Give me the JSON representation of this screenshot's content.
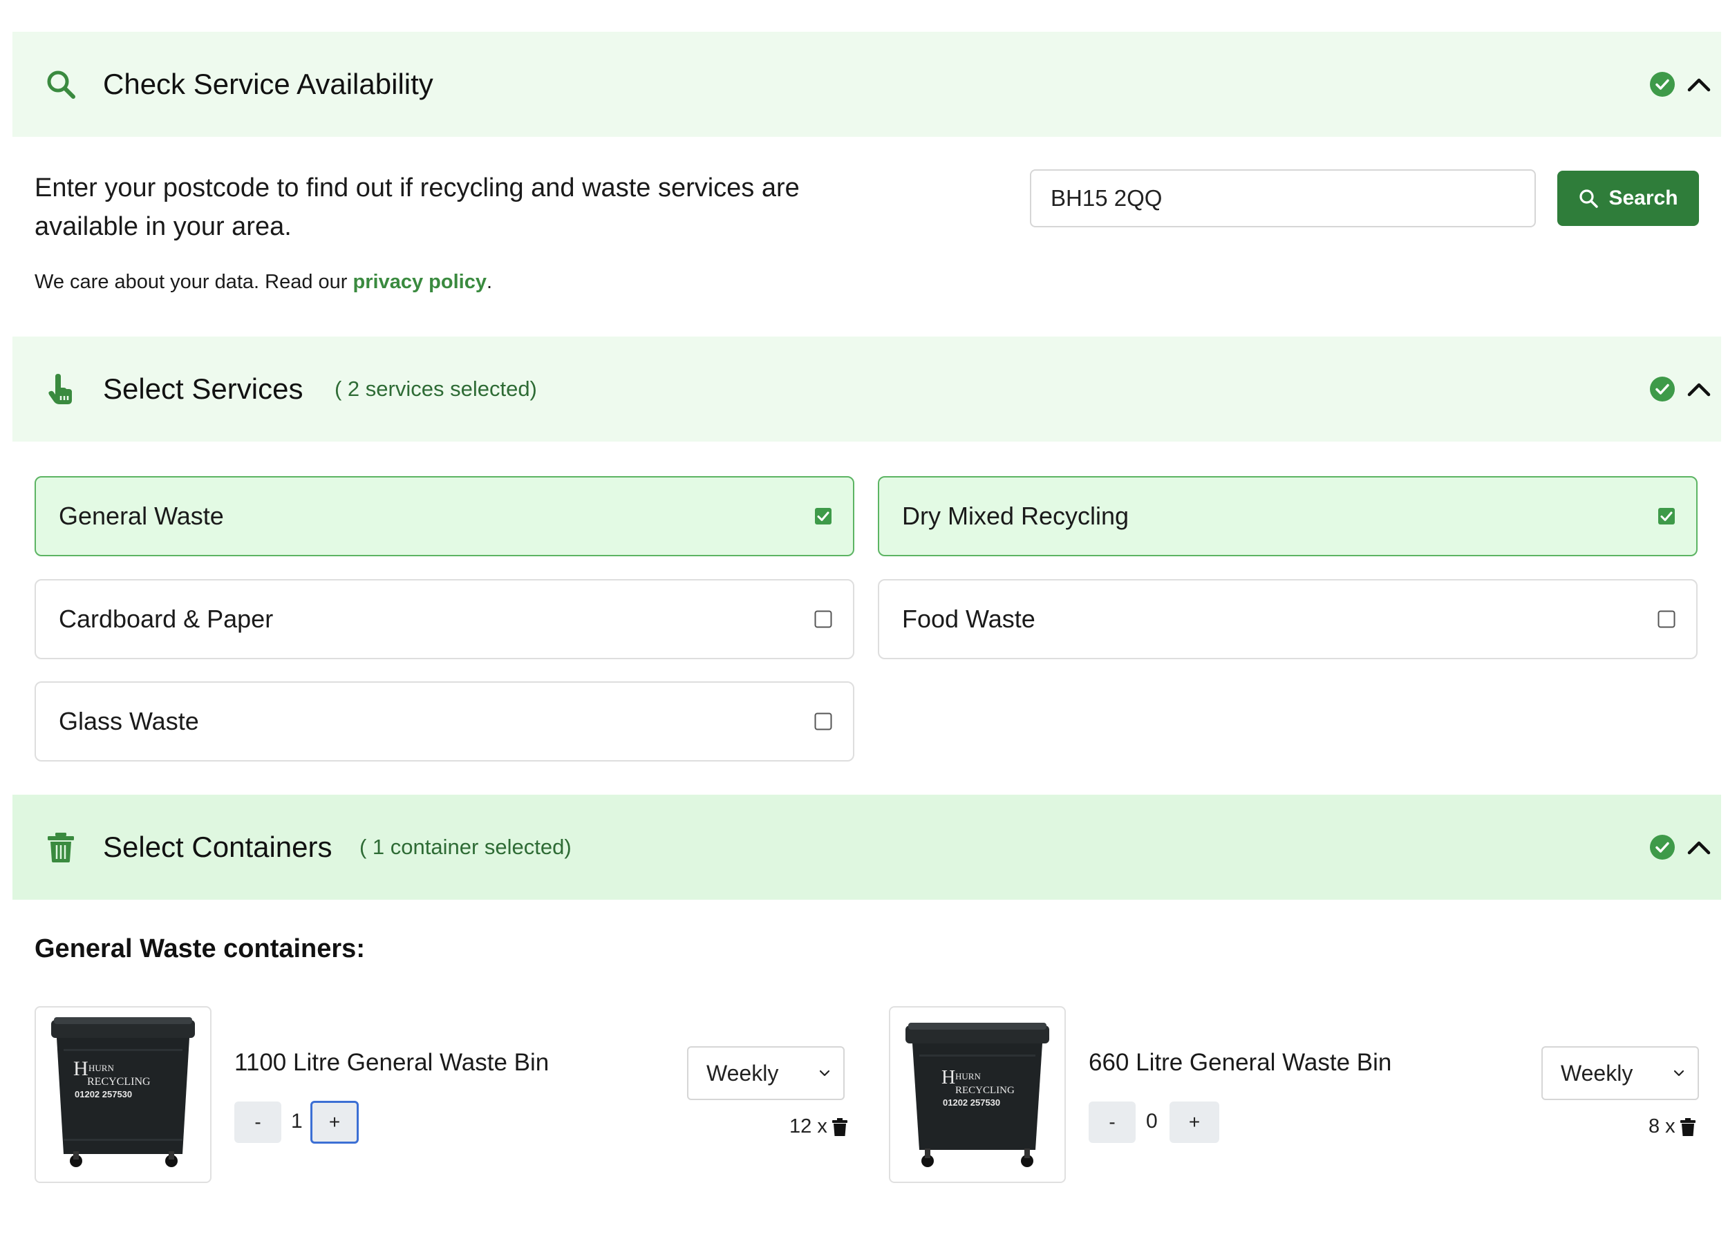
{
  "availability": {
    "title": "Check Service Availability",
    "intro": "Enter your postcode to find out if recycling and waste services are available in your area.",
    "privacy_prefix": "We care about your data. Read our ",
    "privacy_link": "privacy policy",
    "privacy_suffix": ".",
    "postcode_value": "BH15 2QQ",
    "search_label": "Search"
  },
  "services": {
    "title": "Select Services",
    "subtitle": "( 2 services selected)",
    "items": [
      {
        "label": "General Waste",
        "selected": true
      },
      {
        "label": "Dry Mixed Recycling",
        "selected": true
      },
      {
        "label": "Cardboard & Paper",
        "selected": false
      },
      {
        "label": "Food Waste",
        "selected": false
      },
      {
        "label": "Glass Waste",
        "selected": false
      }
    ]
  },
  "containers": {
    "title": "Select Containers",
    "subtitle": "( 1 container selected)",
    "group_heading": "General Waste containers:",
    "bins": [
      {
        "name": "1100 Litre General Waste Bin",
        "quantity": "1",
        "frequency": "Weekly",
        "lifts": "12 x",
        "minus": "-",
        "plus": "+"
      },
      {
        "name": "660 Litre General Waste Bin",
        "quantity": "0",
        "frequency": "Weekly",
        "lifts": "8 x",
        "minus": "-",
        "plus": "+"
      }
    ],
    "bin_logo_line1": "HURN",
    "bin_logo_line2": "RECYCLING",
    "bin_phone": "01202 257530"
  },
  "icons": {
    "availability": "search-icon",
    "services": "hand-pointer-icon",
    "containers": "trash-icon",
    "status": "check-circle-icon",
    "collapse": "chevron-up-icon"
  },
  "colors": {
    "accent": "#2f7d3a",
    "link": "#3a8a3f",
    "selected_bg": "#e3fae4",
    "header_bg": "#eefaee"
  }
}
